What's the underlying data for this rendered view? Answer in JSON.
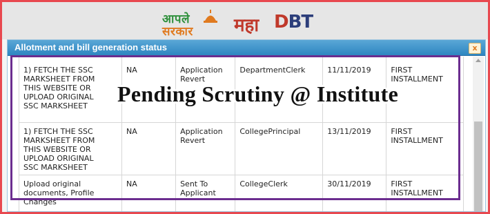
{
  "header": {
    "logo_aaple_line1": "आपले",
    "logo_aaple_line2": "सरकार",
    "logo_maha_prefix": "महा",
    "logo_maha_d": "D",
    "logo_maha_bt": "BT"
  },
  "modal": {
    "title": "Allotment and bill generation status",
    "close_label": "x"
  },
  "overlay": {
    "text": "Pending Scrutiny @ Institute"
  },
  "rows": [
    {
      "remark": "1) FETCH THE SSC\nMARKSHEET FROM\nTHIS WEBSITE OR\nUPLOAD ORIGINAL\nSSC MARKSHEET",
      "value": "NA",
      "status": "Application\nRevert",
      "role": "DepartmentClerk",
      "date": "11/11/2019",
      "installment": "FIRST\nINSTALLMENT"
    },
    {
      "remark": "1) FETCH THE SSC\nMARKSHEET FROM\nTHIS WEBSITE OR\nUPLOAD ORIGINAL\nSSC MARKSHEET",
      "value": "NA",
      "status": "Application\nRevert",
      "role": "CollegePrincipal",
      "date": "13/11/2019",
      "installment": "FIRST\nINSTALLMENT"
    },
    {
      "remark": "Upload original\ndocuments, Profile\nChanges",
      "value": "NA",
      "status": "Sent To\nApplicant",
      "role": "CollegeClerk",
      "date": "30/11/2019",
      "installment": "FIRST\nINSTALLMENT"
    }
  ],
  "colors": {
    "frame_border": "#e8484f",
    "titlebar": "#2e86c1",
    "highlight_border": "#6b2d8f"
  }
}
